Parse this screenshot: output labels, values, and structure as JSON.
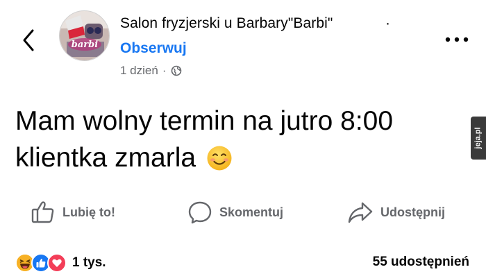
{
  "header": {
    "page_name": "Salon fryzjerski u Barbary\"Barbi\"",
    "name_separator": "·",
    "follow_label": "Obserwuj",
    "time_ago": "1 dzień",
    "meta_separator": "·",
    "privacy_icon": "globe-icon",
    "back_icon": "chevron-left-icon",
    "more_icon": "more-dots-icon",
    "avatar_text": "barbi"
  },
  "post": {
    "line1": "Mam wolny termin na jutro 8:00",
    "line2": "klientka zmarla",
    "emoji": "smiling-face-emoji"
  },
  "actions": {
    "like_label": "Lubię to!",
    "comment_label": "Skomentuj",
    "share_label": "Udostępnij"
  },
  "stats": {
    "reactions": [
      "haha",
      "like",
      "love"
    ],
    "reaction_count": "1 tys.",
    "share_count": "55 udostępnień"
  },
  "watermark": {
    "text": "jeja.pl"
  },
  "colors": {
    "link_blue": "#1877f2",
    "secondary_text": "#65676b",
    "primary_text": "#050505",
    "like_blue": "#1877f2",
    "love_red": "#f33e58",
    "haha_yellow": "#f7b125"
  }
}
